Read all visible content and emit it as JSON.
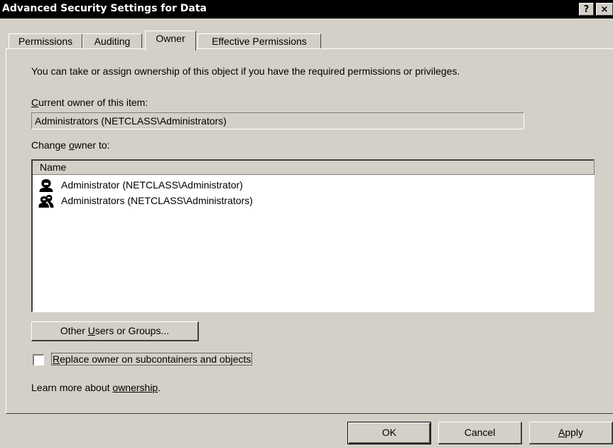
{
  "window": {
    "title": "Advanced Security Settings for Data",
    "help_glyph": "?",
    "close_glyph": "×"
  },
  "tabs": [
    {
      "label": "Permissions",
      "active": false
    },
    {
      "label": "Auditing",
      "active": false
    },
    {
      "label": "Owner",
      "active": true
    },
    {
      "label": "Effective Permissions",
      "active": false
    }
  ],
  "owner_tab": {
    "intro": "You can take or assign ownership of this object if you have the required permissions or privileges.",
    "current_owner_label": "Current owner of this item:",
    "current_owner_value": "Administrators (NETCLASS\\Administrators)",
    "change_owner_label": "Change owner to:",
    "list": {
      "header": "Name",
      "items": [
        {
          "name": "Administrator (NETCLASS\\Administrator)",
          "icon": "user-icon"
        },
        {
          "name": "Administrators (NETCLASS\\Administrators)",
          "icon": "group-icon"
        }
      ]
    },
    "other_users_button": "Other Users or Groups...",
    "replace_checkbox_label": "Replace owner on subcontainers and objects",
    "replace_checked": false,
    "learn_more_prefix": "Learn more about ",
    "learn_more_link": "ownership",
    "learn_more_suffix": "."
  },
  "footer": {
    "ok": "OK",
    "cancel": "Cancel",
    "apply": "Apply"
  }
}
